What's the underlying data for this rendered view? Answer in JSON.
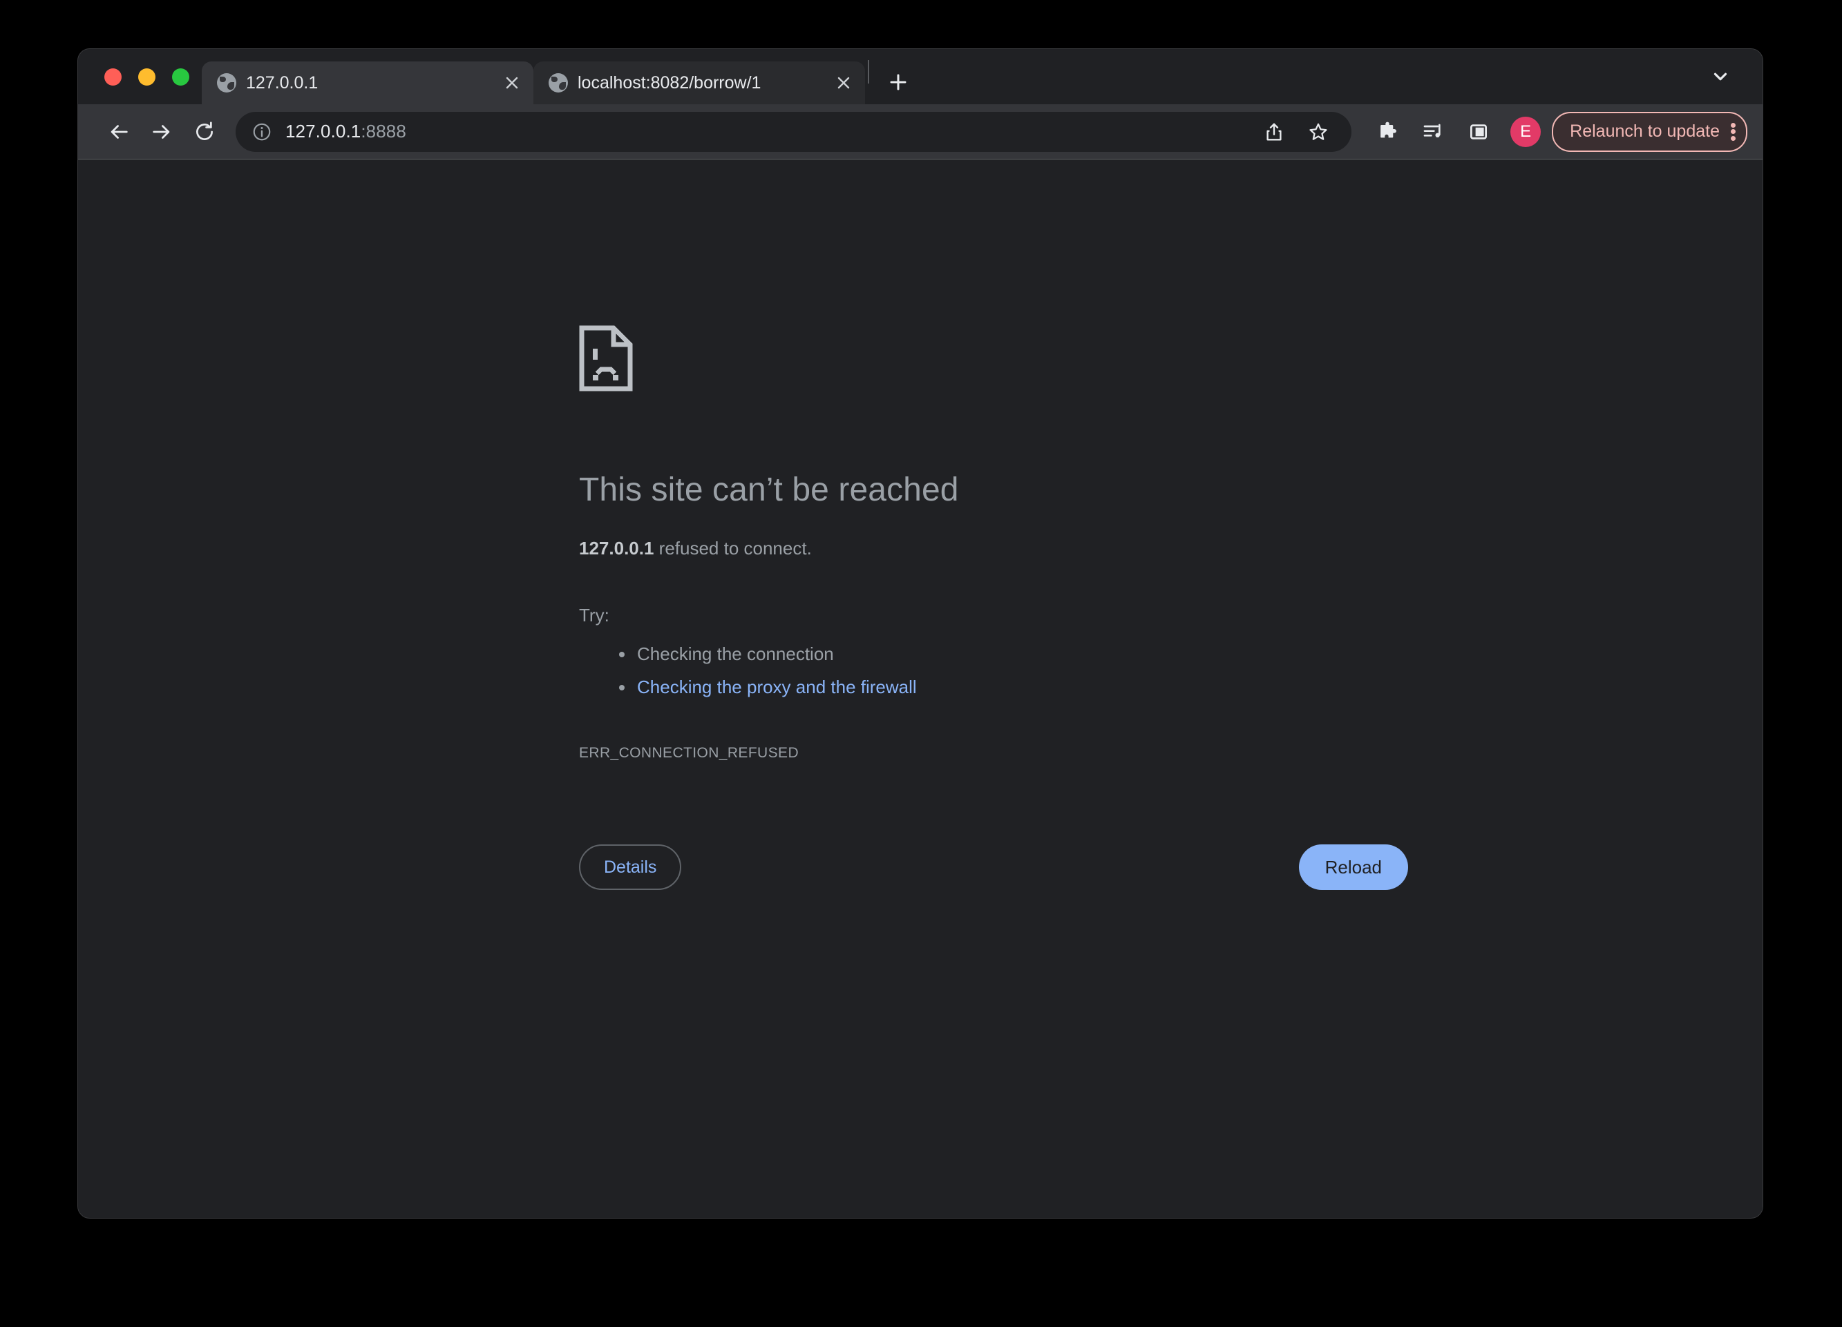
{
  "window": {
    "traffic_lights": {
      "close_color": "#FF5F57",
      "minimize_color": "#FEBC2E",
      "zoom_color": "#28C840"
    }
  },
  "tabstrip": {
    "tabs": [
      {
        "title": "127.0.0.1",
        "active": true,
        "favicon": "globe-icon",
        "close": "×"
      },
      {
        "title": "localhost:8082/borrow/1",
        "active": false,
        "favicon": "globe-icon",
        "close": "×"
      }
    ],
    "new_tab_label": "+",
    "tab_search_label": "⌄"
  },
  "toolbar": {
    "back_label": "←",
    "forward_label": "→",
    "reload_label": "↻",
    "info_label": "ⓘ",
    "url_host": "127.0.0.1",
    "url_port": ":8888",
    "share_label": "share-icon",
    "bookmark_label": "star-icon",
    "extensions_label": "puzzle-icon",
    "media_label": "media-control-icon",
    "side_panel_label": "side-panel-icon",
    "avatar_initial": "E",
    "avatar_color": "#E23A67",
    "relaunch_label": "Relaunch to update",
    "relaunch_color": "#F2B8B5"
  },
  "page": {
    "icon": "sad-page-icon",
    "title": "This site can’t be reached",
    "host": "127.0.0.1",
    "subtitle_rest": " refused to connect.",
    "try_label": "Try:",
    "suggestions": [
      {
        "text": "Checking the connection",
        "is_link": false
      },
      {
        "text": "Checking the proxy and the firewall",
        "is_link": true
      }
    ],
    "error_code": "ERR_CONNECTION_REFUSED",
    "details_button": "Details",
    "reload_button": "Reload",
    "link_color": "#8AB4F8",
    "text_color": "#9aa0a6",
    "background": "#202124"
  }
}
